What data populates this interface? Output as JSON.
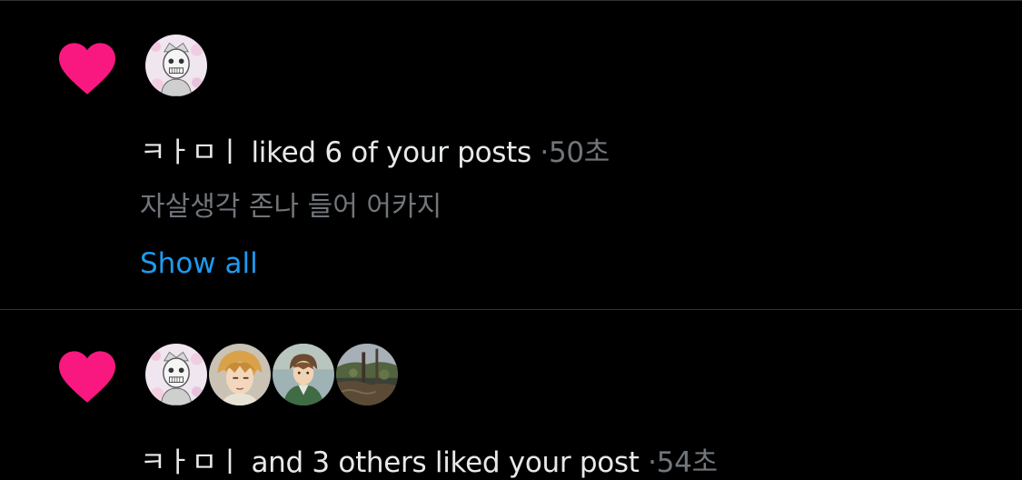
{
  "notifications": [
    {
      "username": "ㅋㅏㅁㅣ",
      "action": "liked 6 of your posts",
      "separator": "·",
      "time": "50초",
      "preview": "자살생각 존나 들어 어카지",
      "show_all_label": "Show all",
      "icon": "heart-icon",
      "avatars": [
        "avatar-sketch-character"
      ]
    },
    {
      "username": "ㅋㅏㅁㅣ",
      "action": "and 3 others liked your post",
      "separator": "·",
      "time": "54초",
      "icon": "heart-icon",
      "avatars": [
        "avatar-sketch-character",
        "avatar-blonde-anime",
        "avatar-brown-hair-anime",
        "avatar-photo-scene"
      ]
    }
  ],
  "colors": {
    "background": "#000000",
    "heart": "#f91880",
    "text_primary": "#e7e9ea",
    "text_secondary": "#71767b",
    "link": "#1d9bf0",
    "divider": "#2f3336"
  }
}
